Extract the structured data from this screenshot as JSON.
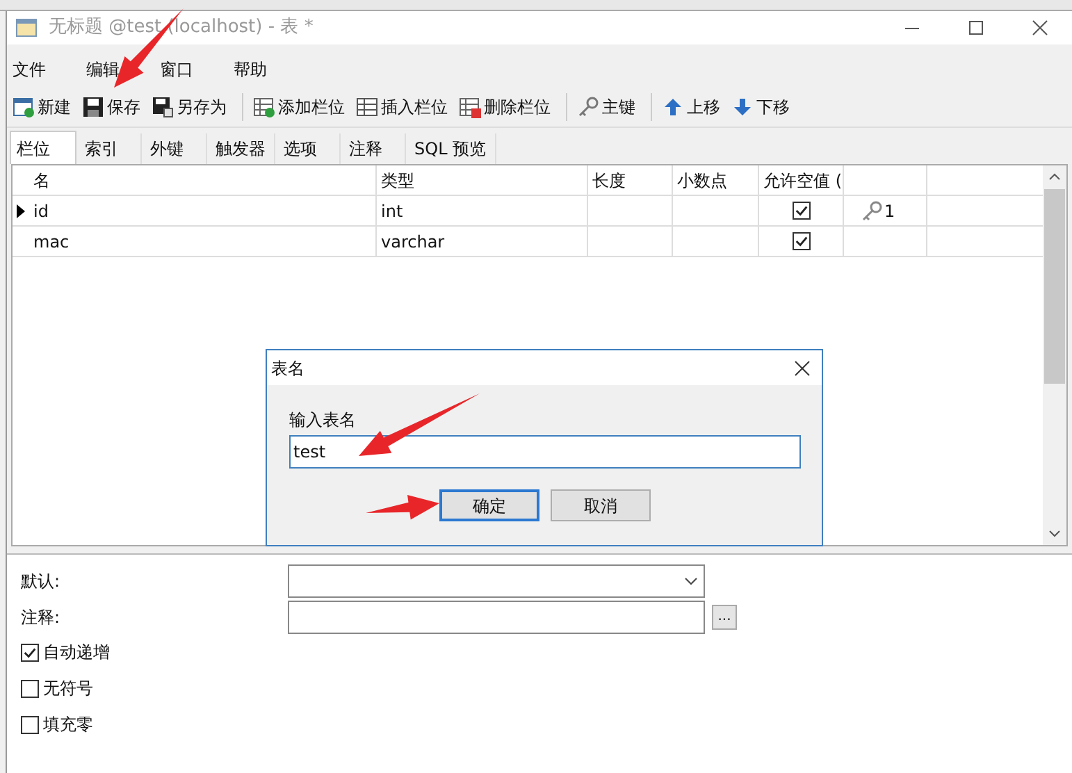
{
  "window": {
    "title": "无标题 @test (localhost) - 表 *"
  },
  "menu": [
    "文件",
    "编辑",
    "窗口",
    "帮助"
  ],
  "toolbar_groups": [
    [
      {
        "kind": "new",
        "label": "新建"
      },
      {
        "kind": "save",
        "label": "保存"
      },
      {
        "kind": "save-as",
        "label": "另存为"
      }
    ],
    [
      {
        "kind": "add-column",
        "label": "添加栏位"
      },
      {
        "kind": "insert-column",
        "label": "插入栏位"
      },
      {
        "kind": "delete-column",
        "label": "删除栏位"
      }
    ],
    [
      {
        "kind": "key",
        "label": "主键"
      }
    ],
    [
      {
        "kind": "up",
        "label": "上移"
      },
      {
        "kind": "down",
        "label": "下移"
      }
    ]
  ],
  "tabs": [
    {
      "label": "栏位",
      "selected": true
    },
    {
      "label": "索引",
      "selected": false
    },
    {
      "label": "外键",
      "selected": false
    },
    {
      "label": "触发器",
      "selected": false
    },
    {
      "label": "选项",
      "selected": false
    },
    {
      "label": "注释",
      "selected": false
    },
    {
      "label": "SQL 预览",
      "selected": false
    }
  ],
  "table": {
    "columns": [
      "名",
      "类型",
      "长度",
      "小数点",
      "允许空值 ("
    ],
    "rows": [
      {
        "name": "id",
        "type": "int",
        "nullable": true,
        "key": "1",
        "current": true
      },
      {
        "name": "mac",
        "type": "varchar",
        "nullable": true,
        "current": false
      }
    ]
  },
  "dialog": {
    "title": "表名",
    "label": "输入表名",
    "value": "test",
    "buttons": [
      {
        "label": "确定",
        "default": true
      },
      {
        "label": "取消",
        "default": false
      }
    ]
  },
  "properties": {
    "default_label": "默认:",
    "comment_label": "注释:",
    "comment_button": "...",
    "options": [
      {
        "label": "自动递增",
        "checked": true
      },
      {
        "label": "无符号",
        "checked": false
      },
      {
        "label": "填充零",
        "checked": false
      }
    ]
  }
}
